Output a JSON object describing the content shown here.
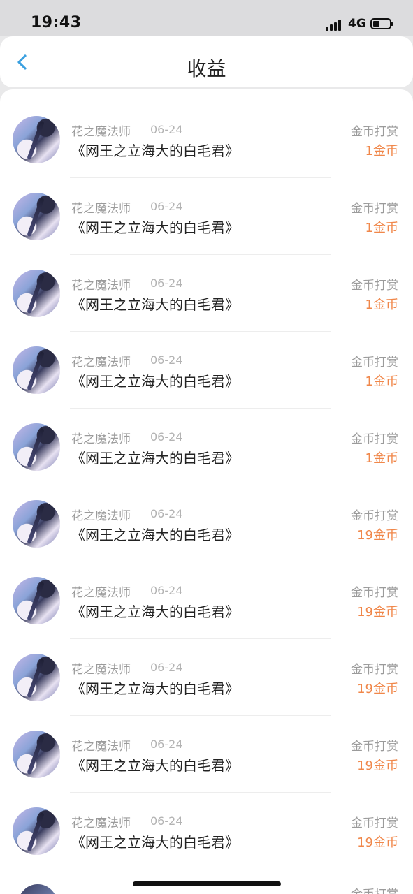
{
  "status_bar": {
    "time": "19:43",
    "network": "4G"
  },
  "header": {
    "title": "收益"
  },
  "colors": {
    "accent": "#3aa0e0",
    "amount": "#f0874a"
  },
  "records": [
    {
      "name": "花之魔法师",
      "date": "06-24",
      "book": "《网王之立海大的白毛君》",
      "type": "金币打赏",
      "amount": "1金币"
    },
    {
      "name": "花之魔法师",
      "date": "06-24",
      "book": "《网王之立海大的白毛君》",
      "type": "金币打赏",
      "amount": "1金币"
    },
    {
      "name": "花之魔法师",
      "date": "06-24",
      "book": "《网王之立海大的白毛君》",
      "type": "金币打赏",
      "amount": "1金币"
    },
    {
      "name": "花之魔法师",
      "date": "06-24",
      "book": "《网王之立海大的白毛君》",
      "type": "金币打赏",
      "amount": "1金币"
    },
    {
      "name": "花之魔法师",
      "date": "06-24",
      "book": "《网王之立海大的白毛君》",
      "type": "金币打赏",
      "amount": "1金币"
    },
    {
      "name": "花之魔法师",
      "date": "06-24",
      "book": "《网王之立海大的白毛君》",
      "type": "金币打赏",
      "amount": "19金币"
    },
    {
      "name": "花之魔法师",
      "date": "06-24",
      "book": "《网王之立海大的白毛君》",
      "type": "金币打赏",
      "amount": "19金币"
    },
    {
      "name": "花之魔法师",
      "date": "06-24",
      "book": "《网王之立海大的白毛君》",
      "type": "金币打赏",
      "amount": "19金币"
    },
    {
      "name": "花之魔法师",
      "date": "06-24",
      "book": "《网王之立海大的白毛君》",
      "type": "金币打赏",
      "amount": "19金币"
    },
    {
      "name": "花之魔法师",
      "date": "06-24",
      "book": "《网王之立海大的白毛君》",
      "type": "金币打赏",
      "amount": "19金币"
    }
  ],
  "partial_row": {
    "type": "金币打赏"
  }
}
